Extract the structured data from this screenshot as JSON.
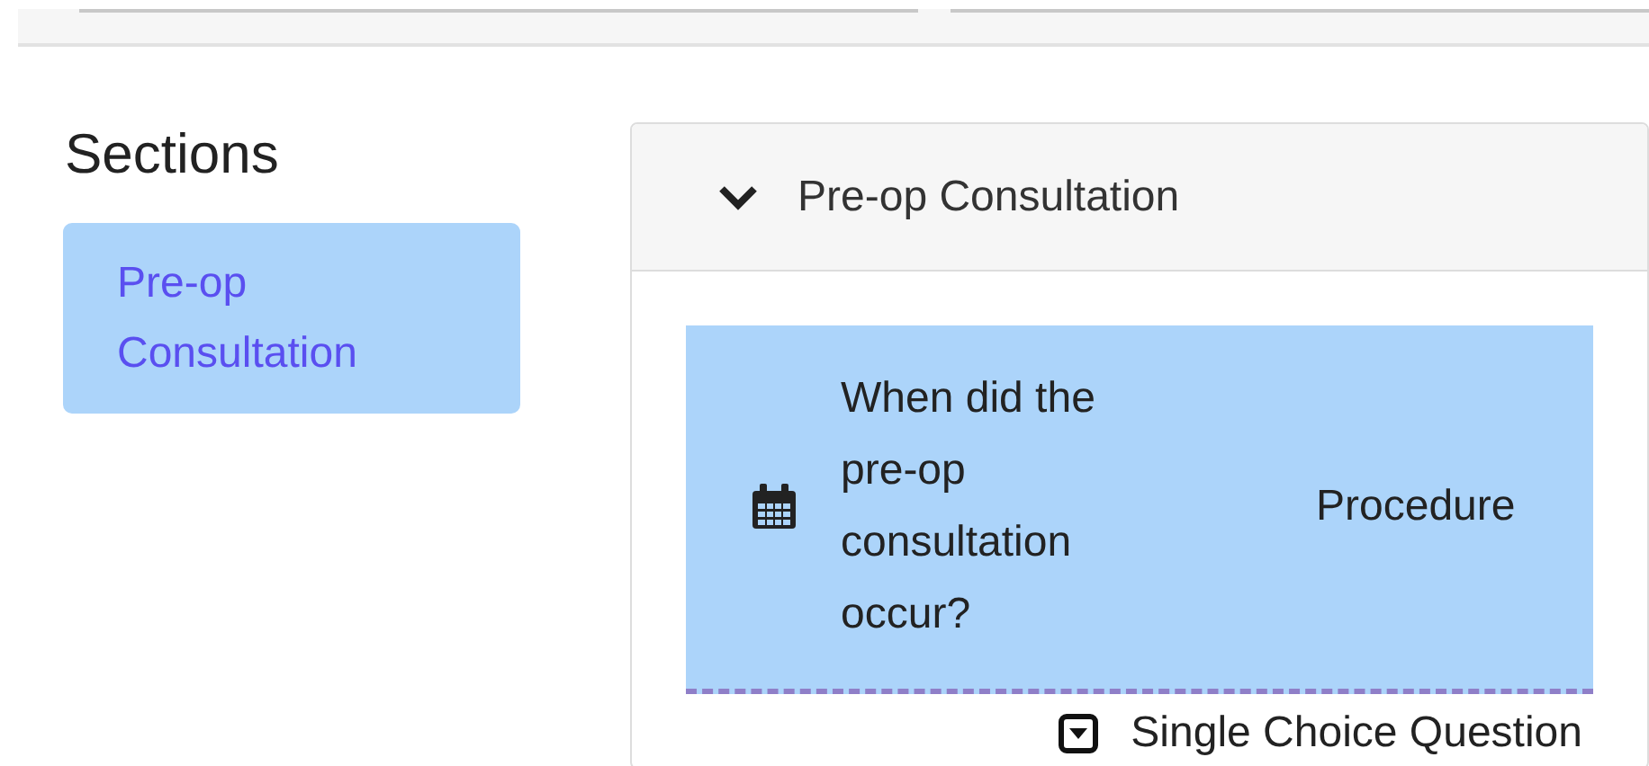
{
  "sidebar": {
    "heading": "Sections",
    "items": [
      {
        "label": "Pre-op Consultation",
        "selected": true
      }
    ]
  },
  "section": {
    "title": "Pre-op Consultation",
    "expanded": true,
    "questions": [
      {
        "text": "When did the pre-op consultation occur?",
        "category": "Procedure",
        "type": "Single Choice Question",
        "selected": true
      }
    ]
  }
}
